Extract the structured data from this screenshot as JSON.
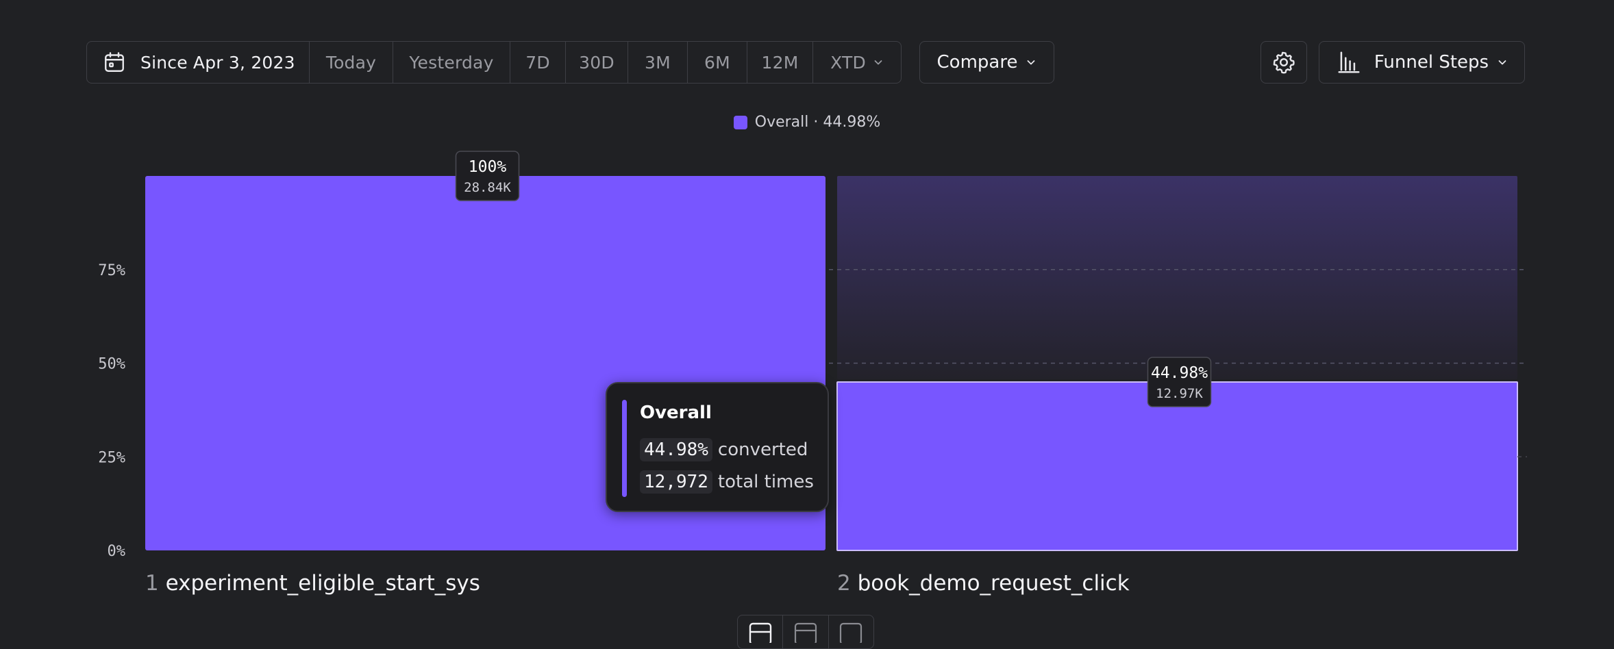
{
  "toolbar": {
    "date_range": "Since Apr 3, 2023",
    "presets": [
      "Today",
      "Yesterday",
      "7D",
      "30D",
      "3M",
      "6M",
      "12M",
      "XTD"
    ],
    "compare_label": "Compare",
    "chart_type_label": "Funnel Steps"
  },
  "legend": {
    "label": "Overall · 44.98%",
    "color": "#7856ff"
  },
  "tooltip": {
    "title": "Overall",
    "converted_value": "44.98%",
    "converted_label": "converted",
    "total_value": "12,972",
    "total_label": "total times"
  },
  "chart_data": {
    "type": "bar",
    "categories": [
      "experiment_eligible_start_sys",
      "book_demo_request_click"
    ],
    "step_numbers": [
      "1",
      "2"
    ],
    "series": [
      {
        "name": "Overall",
        "values": [
          100,
          44.98
        ],
        "counts": [
          "28.84K",
          "12.97K"
        ],
        "labels": [
          "100%",
          "44.98%"
        ]
      }
    ],
    "yticks": [
      "0%",
      "25%",
      "50%",
      "75%"
    ],
    "ylim": [
      0,
      100
    ],
    "ylabel": "",
    "xlabel": "",
    "grid": true,
    "bar_color": "#7856ff"
  }
}
